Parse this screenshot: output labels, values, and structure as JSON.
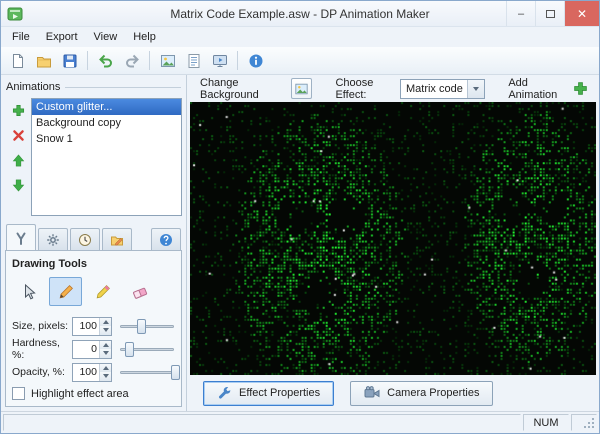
{
  "window": {
    "title": "Matrix Code Example.asw - DP Animation Maker"
  },
  "menu": {
    "items": [
      "File",
      "Export",
      "View",
      "Help"
    ]
  },
  "toolbar": {
    "buttons": [
      "new-document",
      "open-file",
      "save-file",
      "undo",
      "redo",
      "add-background-image",
      "add-text",
      "make-video",
      "about-info"
    ]
  },
  "animations_panel": {
    "header": "Animations",
    "items": [
      {
        "label": "Custom glitter...",
        "selected": true
      },
      {
        "label": "Background copy",
        "selected": false
      },
      {
        "label": "Snow 1",
        "selected": false
      }
    ]
  },
  "tool_tabs": [
    "drawing-tools",
    "effect-settings",
    "timing",
    "file-tools",
    "help"
  ],
  "drawing_tools": {
    "header": "Drawing Tools",
    "tools": [
      "select-arrow",
      "pencil",
      "marker",
      "eraser"
    ],
    "selected_tool": "pencil",
    "size": {
      "label": "Size, pixels:",
      "value": "100"
    },
    "hardness": {
      "label": "Hardness, %:",
      "value": "0"
    },
    "opacity": {
      "label": "Opacity, %:",
      "value": "100"
    },
    "highlight_label": "Highlight effect area",
    "highlight_checked": false
  },
  "effect_bar": {
    "change_background_label": "Change Background",
    "choose_effect_label": "Choose Effect:",
    "effect_value": "Matrix code",
    "add_animation_label": "Add Animation"
  },
  "properties_bar": {
    "effect_properties_label": "Effect Properties",
    "camera_properties_label": "Camera Properties"
  },
  "status_bar": {
    "num_label": "NUM"
  },
  "colors": {
    "selection_blue": "#3d7bd4",
    "matrix_green": "#35c035",
    "accent_green": "#3fae49",
    "close_red": "#d9675f"
  }
}
